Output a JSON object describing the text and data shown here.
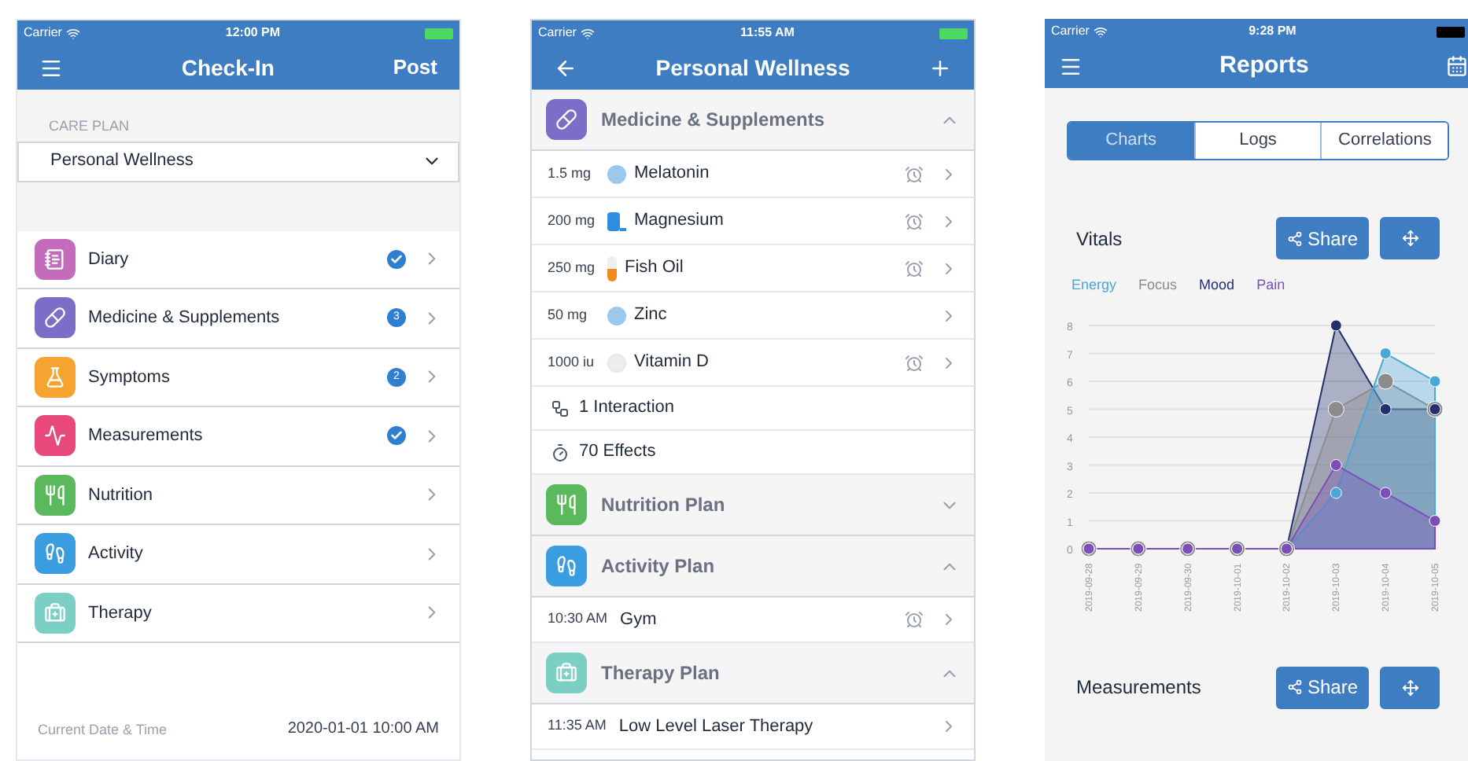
{
  "checkin": {
    "status_bar": {
      "carrier": "Carrier",
      "time": "12:00 PM"
    },
    "nav": {
      "title": "Check-In",
      "action": "Post"
    },
    "care_plan": {
      "label": "CARE PLAN",
      "value": "Personal Wellness"
    },
    "items": [
      {
        "label": "Diary",
        "color": "#c36cbc",
        "badge": {
          "kind": "check"
        }
      },
      {
        "label": "Medicine & Supplements",
        "color": "#7a6ec6",
        "badge": {
          "kind": "count",
          "text": "3"
        }
      },
      {
        "label": "Symptoms",
        "color": "#f5a331",
        "badge": {
          "kind": "count",
          "text": "2"
        }
      },
      {
        "label": "Measurements",
        "color": "#e8497a",
        "badge": {
          "kind": "check"
        }
      },
      {
        "label": "Nutrition",
        "color": "#5cb85c"
      },
      {
        "label": "Activity",
        "color": "#3a9de0"
      },
      {
        "label": "Therapy",
        "color": "#7ccfc4"
      }
    ],
    "footer": {
      "label": "Current Date & Time",
      "value": "2020-01-01 10:00 AM"
    }
  },
  "plan": {
    "status_bar": {
      "carrier": "Carrier",
      "time": "11:55 AM"
    },
    "nav": {
      "title": "Personal Wellness"
    },
    "sections": [
      {
        "title": "Medicine & Supplements",
        "color": "#7a6ec6",
        "expanded": true,
        "rows": [
          {
            "kind": "medication",
            "dose": "1.5 mg",
            "name": "Melatonin",
            "alarm": true
          },
          {
            "kind": "medication",
            "dose": "200 mg",
            "name": "Magnesium",
            "alarm": true
          },
          {
            "kind": "medication",
            "dose": "250 mg",
            "name": "Fish Oil",
            "alarm": true
          },
          {
            "kind": "medication",
            "dose": "50 mg",
            "name": "Zinc",
            "alarm": false
          },
          {
            "kind": "medication",
            "dose": "1000 iu",
            "name": "Vitamin D",
            "alarm": true
          },
          {
            "kind": "interaction",
            "text": "1 Interaction"
          },
          {
            "kind": "effects",
            "text": "70 Effects"
          }
        ]
      },
      {
        "title": "Nutrition Plan",
        "color": "#5cb85c",
        "expanded": false
      },
      {
        "title": "Activity Plan",
        "color": "#3a9de0",
        "expanded": true,
        "rows": [
          {
            "kind": "schedule",
            "time": "10:30 AM",
            "name": "Gym",
            "alarm": true
          }
        ]
      },
      {
        "title": "Therapy Plan",
        "color": "#7ccfc4",
        "expanded": true,
        "rows": [
          {
            "kind": "schedule",
            "time": "11:35 AM",
            "name": "Low Level Laser Therapy",
            "alarm": false
          }
        ]
      }
    ]
  },
  "reports": {
    "status_bar": {
      "carrier": "Carrier",
      "time": "9:28 PM"
    },
    "nav": {
      "title": "Reports"
    },
    "tabs": [
      {
        "label": "Charts",
        "selected": true
      },
      {
        "label": "Logs",
        "selected": false
      },
      {
        "label": "Correlations",
        "selected": false
      }
    ],
    "panels": [
      {
        "title": "Vitals",
        "share": "Share",
        "chart_data": {
          "type": "area",
          "categories": [
            "2019-09-28",
            "2019-09-29",
            "2019-09-30",
            "2019-10-01",
            "2019-10-02",
            "2019-10-03",
            "2019-10-04",
            "2019-10-05"
          ],
          "series": [
            {
              "name": "Energy",
              "color": "#4aa7d8",
              "values": [
                0,
                0,
                0,
                0,
                0,
                2,
                7,
                6
              ]
            },
            {
              "name": "Focus",
              "color": "#8c8c8c",
              "values": [
                0,
                0,
                0,
                0,
                0,
                5,
                6,
                5
              ]
            },
            {
              "name": "Mood",
              "color": "#24306e",
              "values": [
                0,
                0,
                0,
                0,
                0,
                8,
                5,
                5
              ]
            },
            {
              "name": "Pain",
              "color": "#7a4fb8",
              "values": [
                0,
                0,
                0,
                0,
                0,
                3,
                2,
                1
              ]
            }
          ],
          "ylim": [
            0,
            8
          ],
          "yticks": [
            0,
            1,
            2,
            3,
            4,
            5,
            6,
            7,
            8
          ],
          "grid": true
        }
      },
      {
        "title": "Measurements",
        "share": "Share"
      }
    ]
  }
}
